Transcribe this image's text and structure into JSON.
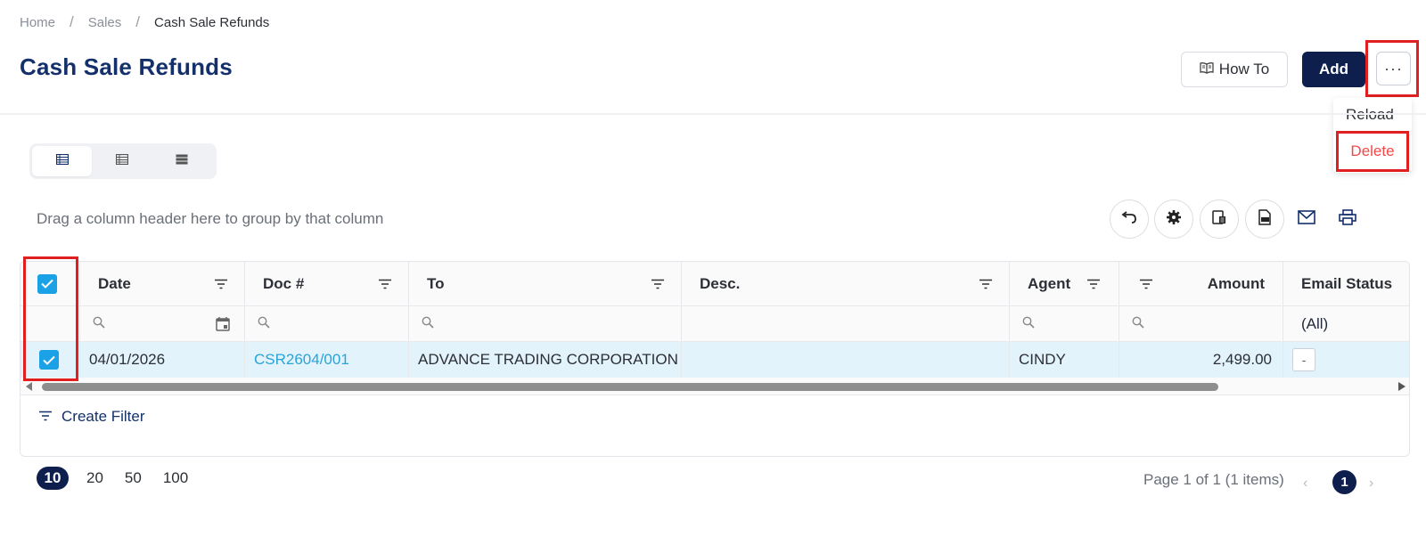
{
  "breadcrumb": {
    "home": "Home",
    "sales": "Sales",
    "current": "Cash Sale Refunds",
    "separator": "/"
  },
  "page": {
    "title": "Cash Sale Refunds"
  },
  "actions": {
    "how_to": "How To",
    "add": "Add",
    "more": "···"
  },
  "more_menu": {
    "reload": "Reload",
    "delete": "Delete"
  },
  "grid": {
    "group_hint": "Drag a column header here to group by that column",
    "columns": [
      "Date",
      "Doc #",
      "To",
      "Desc.",
      "Agent",
      "Amount",
      "Email Status"
    ],
    "email_filter": "(All)",
    "rows": [
      {
        "date": "04/01/2026",
        "doc": "CSR2604/001",
        "to": "ADVANCE TRADING CORPORATION",
        "desc": "",
        "agent": "CINDY",
        "amount": "2,499.00",
        "email_status": "-"
      }
    ],
    "create_filter": "Create Filter"
  },
  "pagination": {
    "sizes": [
      "10",
      "20",
      "50",
      "100"
    ],
    "active_size": "10",
    "info": "Page 1 of 1 (1 items)",
    "current_page": "1",
    "prev": "‹",
    "next": "›"
  },
  "colors": {
    "primary": "#0e1f4d",
    "title": "#14306b",
    "checkbox": "#1aa1e6",
    "link": "#2aa3d8",
    "danger": "#f24848",
    "highlight": "#e02020",
    "selected_row": "#e3f3fb"
  }
}
